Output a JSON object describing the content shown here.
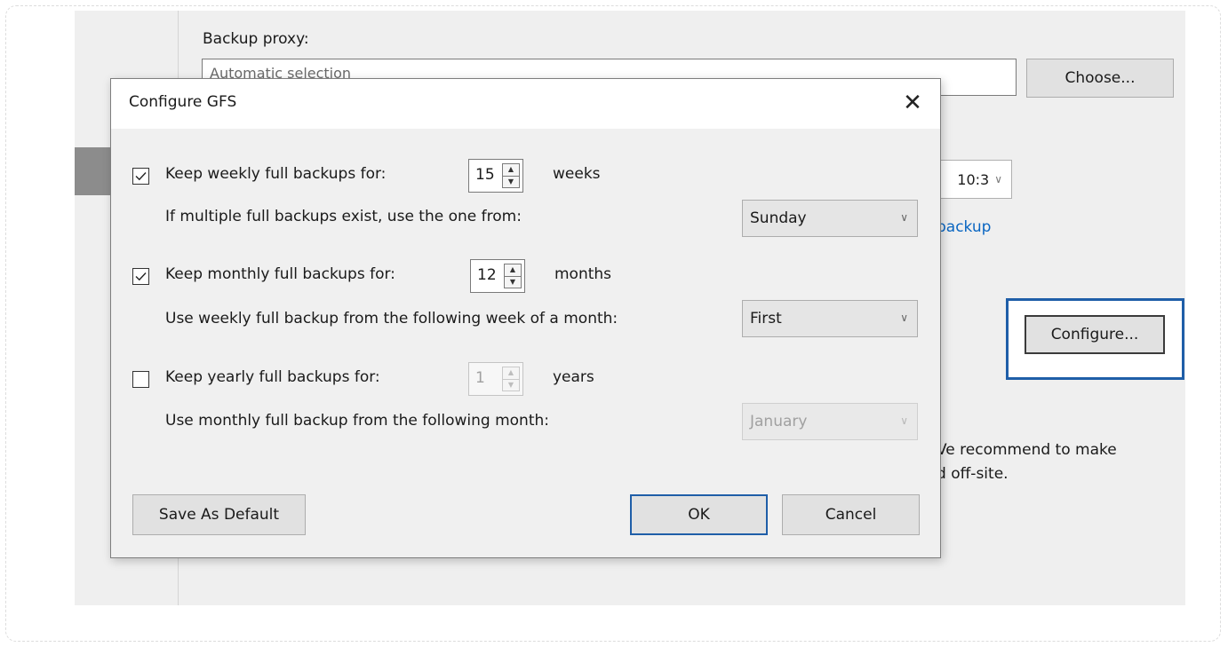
{
  "background": {
    "proxy_label": "Backup proxy:",
    "proxy_value": "Automatic selection",
    "choose_label": "Choose...",
    "time_value": "10:3",
    "backup_link": "backup",
    "configure_label": "Configure...",
    "recommend_line1": "Ve recommend to make",
    "recommend_line2": "d off-site."
  },
  "dialog": {
    "title": "Configure GFS",
    "close_glyph": "✕",
    "weekly": {
      "checked": true,
      "label": "Keep weekly full backups for:",
      "value": "15",
      "unit": "weeks",
      "sub_label": "If multiple full backups exist, use the one from:",
      "select_value": "Sunday"
    },
    "monthly": {
      "checked": true,
      "label": "Keep monthly full backups for:",
      "value": "12",
      "unit": "months",
      "sub_label": "Use weekly full backup from the following week of a month:",
      "select_value": "First"
    },
    "yearly": {
      "checked": false,
      "label": "Keep yearly full backups for:",
      "value": "1",
      "unit": "years",
      "sub_label": "Use monthly full backup from the following month:",
      "select_value": "January"
    },
    "buttons": {
      "save_default": "Save As Default",
      "ok": "OK",
      "cancel": "Cancel"
    }
  },
  "colors": {
    "accent": "#1f5ea8",
    "link": "#0a66c2"
  }
}
